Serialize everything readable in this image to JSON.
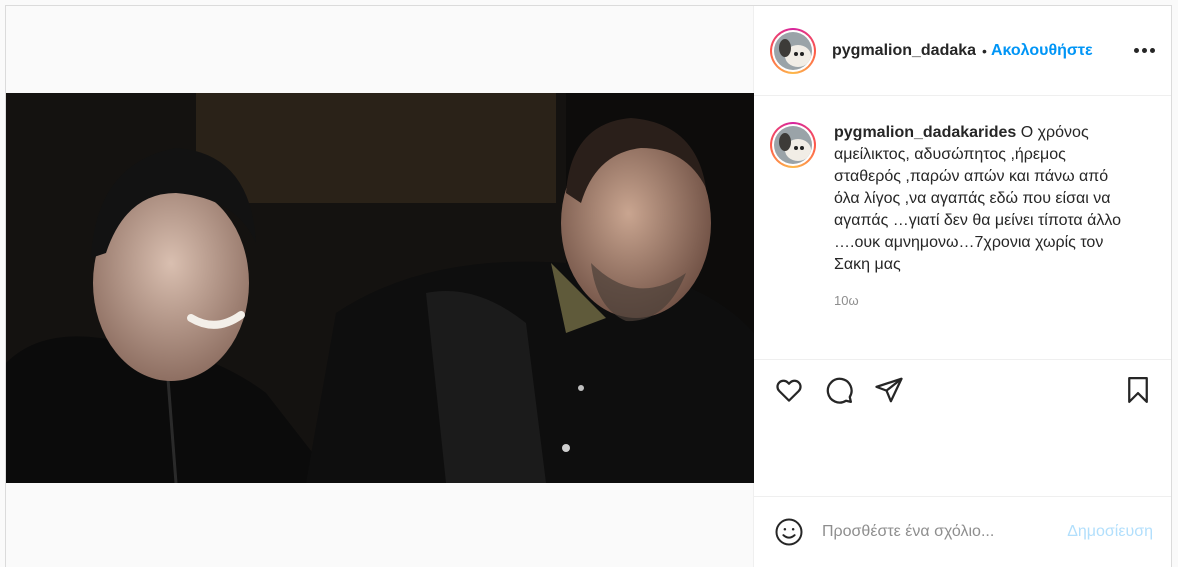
{
  "post": {
    "username": "pygmalion_dadakarides",
    "header_username_display": "pygmalion_dadaka",
    "follow_label": "Ακολουθήστε",
    "separator": "•",
    "caption_text": "Ο χρόνος αμείλικτος, αδυσώπητος ,ήρεμος σταθερός ,παρών απών και πάνω από όλα λίγος ,να αγαπάς εδώ που είσαι να αγαπάς …γιατί δεν θα μείνει τίποτα άλλο ….ουκ αμνημονω…7χρονια χωρίς τον Σακη μας",
    "time_ago": "10ω"
  },
  "icons": {
    "like": "heart-icon",
    "comment": "comment-icon",
    "share": "send-icon",
    "save": "bookmark-icon",
    "more": "more-options-icon",
    "emoji": "emoji-icon"
  },
  "comment_box": {
    "placeholder": "Προσθέστε ένα σχόλιο...",
    "post_label": "Δημοσίευση"
  },
  "colors": {
    "accent": "#0095f6",
    "post_disabled": "#b2dffc",
    "muted": "#8e8e8e",
    "text": "#262626"
  }
}
